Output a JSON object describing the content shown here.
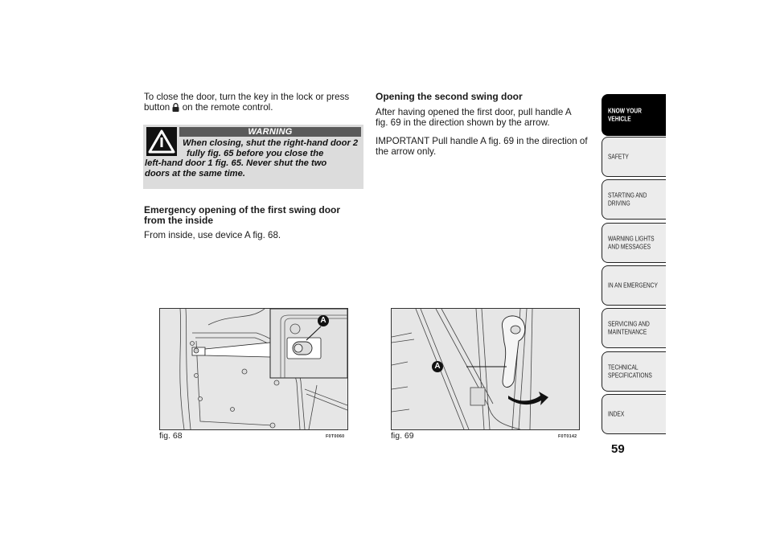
{
  "left_column": {
    "intro_text_line1": "To close the door, turn the key in the lock or press",
    "intro_text_line2_before": "button",
    "intro_text_line2_icon": "padlock-icon",
    "intro_text_line2_after": "on the remote control.",
    "warning": {
      "title": "WARNING",
      "icon": "warning-triangle-icon",
      "lines": [
        "When closing, shut the right-hand door 2",
        "fully fig. 65 before you close the",
        "left-hand door 1 fig. 65. Never shut the two",
        "doors at the same time."
      ]
    },
    "heading_line1": "Emergency opening of the first swing door",
    "heading_line2": "from the inside",
    "body": "From inside, use device A fig. 68."
  },
  "right_column": {
    "heading": "Opening the second swing door",
    "para1_line1": "After having opened the first door, pull handle A",
    "para1_line2": "fig. 69 in the direction shown by the arrow.",
    "para2_line1": "IMPORTANT Pull handle A fig. 69 in the direction of",
    "para2_line2": "the arrow only."
  },
  "figures": [
    {
      "caption": "fig. 68",
      "code": "F0T0060",
      "callout": "A"
    },
    {
      "caption": "fig. 69",
      "code": "F0T0142",
      "callout": "A"
    }
  ],
  "side_tabs": [
    {
      "label": "KNOW YOUR\nVEHICLE",
      "active": true
    },
    {
      "label": "SAFETY",
      "active": false
    },
    {
      "label": "STARTING AND\nDRIVING",
      "active": false
    },
    {
      "label": "WARNING LIGHTS\nAND MESSAGES",
      "active": false
    },
    {
      "label": "IN AN EMERGENCY",
      "active": false
    },
    {
      "label": "SERVICING AND\nMAINTENANCE",
      "active": false
    },
    {
      "label": "TECHNICAL\nSPECIFICATIONS",
      "active": false
    },
    {
      "label": "INDEX",
      "active": false
    }
  ],
  "page_number": "59"
}
